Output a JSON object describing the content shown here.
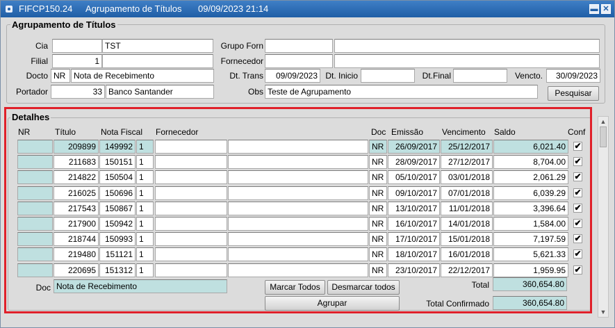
{
  "window": {
    "form_code": "FIFCP150.24",
    "form_title": "Agrupamento de Títulos",
    "datetime": "09/09/2023 21:14",
    "minimize_label": "▬",
    "close_label": "✕"
  },
  "header": {
    "title": "Agrupamento de Títulos",
    "cia_label": "Cia",
    "cia_code": "",
    "cia_name": "TST",
    "grupo_forn_label": "Grupo Forn",
    "grupo_forn_code": "",
    "grupo_forn_name": "",
    "filial_label": "Filial",
    "filial_code": "1",
    "filial_name": "",
    "fornecedor_label": "Fornecedor",
    "fornecedor_code": "",
    "fornecedor_name": "",
    "docto_label": "Docto",
    "docto_code": "NR",
    "docto_name": "Nota de Recebimento",
    "dt_trans_label": "Dt. Trans",
    "dt_trans": "09/09/2023",
    "dt_inicio_label": "Dt. Inicio",
    "dt_inicio": "",
    "dt_final_label": "Dt.Final",
    "dt_final": "",
    "vencto_label": "Vencto.",
    "vencto": "30/09/2023",
    "portador_label": "Portador",
    "portador_code": "33",
    "portador_name": "Banco Santander",
    "obs_label": "Obs",
    "obs": "Teste de Agrupamento",
    "pesquisar_label": "Pesquisar"
  },
  "details": {
    "title": "Detalhes",
    "columns": {
      "nr": "NR",
      "titulo": "Título",
      "nota_fiscal": "Nota Fiscal",
      "fornecedor": "Fornecedor",
      "doc": "Doc",
      "emissao": "Emissão",
      "vencimento": "Vencimento",
      "saldo": "Saldo",
      "conf": "Conf"
    },
    "rows": [
      {
        "nr": "",
        "titulo": "209899",
        "nf": "149992",
        "serie": "1",
        "forn_code": "",
        "forn_name": "",
        "doc": "NR",
        "emissao": "26/09/2017",
        "vencimento": "25/12/2017",
        "saldo": "6,021.40",
        "conf": "✔"
      },
      {
        "nr": "",
        "titulo": "211683",
        "nf": "150151",
        "serie": "1",
        "forn_code": "",
        "forn_name": "",
        "doc": "NR",
        "emissao": "28/09/2017",
        "vencimento": "27/12/2017",
        "saldo": "8,704.00",
        "conf": "✔"
      },
      {
        "nr": "",
        "titulo": "214822",
        "nf": "150504",
        "serie": "1",
        "forn_code": "",
        "forn_name": "",
        "doc": "NR",
        "emissao": "05/10/2017",
        "vencimento": "03/01/2018",
        "saldo": "2,061.29",
        "conf": "✔"
      },
      {
        "nr": "",
        "titulo": "216025",
        "nf": "150696",
        "serie": "1",
        "forn_code": "",
        "forn_name": "",
        "doc": "NR",
        "emissao": "09/10/2017",
        "vencimento": "07/01/2018",
        "saldo": "6,039.29",
        "conf": "✔"
      },
      {
        "nr": "",
        "titulo": "217543",
        "nf": "150867",
        "serie": "1",
        "forn_code": "",
        "forn_name": "",
        "doc": "NR",
        "emissao": "13/10/2017",
        "vencimento": "11/01/2018",
        "saldo": "3,396.64",
        "conf": "✔"
      },
      {
        "nr": "",
        "titulo": "217900",
        "nf": "150942",
        "serie": "1",
        "forn_code": "",
        "forn_name": "",
        "doc": "NR",
        "emissao": "16/10/2017",
        "vencimento": "14/01/2018",
        "saldo": "1,584.00",
        "conf": "✔"
      },
      {
        "nr": "",
        "titulo": "218744",
        "nf": "150993",
        "serie": "1",
        "forn_code": "",
        "forn_name": "",
        "doc": "NR",
        "emissao": "17/10/2017",
        "vencimento": "15/01/2018",
        "saldo": "7,197.59",
        "conf": "✔"
      },
      {
        "nr": "",
        "titulo": "219480",
        "nf": "151121",
        "serie": "1",
        "forn_code": "",
        "forn_name": "",
        "doc": "NR",
        "emissao": "18/10/2017",
        "vencimento": "16/01/2018",
        "saldo": "5,621.33",
        "conf": "✔"
      },
      {
        "nr": "",
        "titulo": "220695",
        "nf": "151312",
        "serie": "1",
        "forn_code": "",
        "forn_name": "",
        "doc": "NR",
        "emissao": "23/10/2017",
        "vencimento": "22/12/2017",
        "saldo": "1,959.95",
        "conf": "✔"
      }
    ],
    "doc_label": "Doc",
    "doc_desc": "Nota de Recebimento",
    "marcar_todos_label": "Marcar Todos",
    "desmarcar_todos_label": "Desmarcar todos",
    "agrupar_label": "Agrupar",
    "total_label": "Total",
    "total": "360,654.80",
    "total_confirmado_label": "Total Confirmado",
    "total_confirmado": "360,654.80"
  },
  "colors": {
    "title_bar": "#2a6db5",
    "highlight_border": "#e0202a",
    "readonly_field": "#bfe0e0"
  }
}
